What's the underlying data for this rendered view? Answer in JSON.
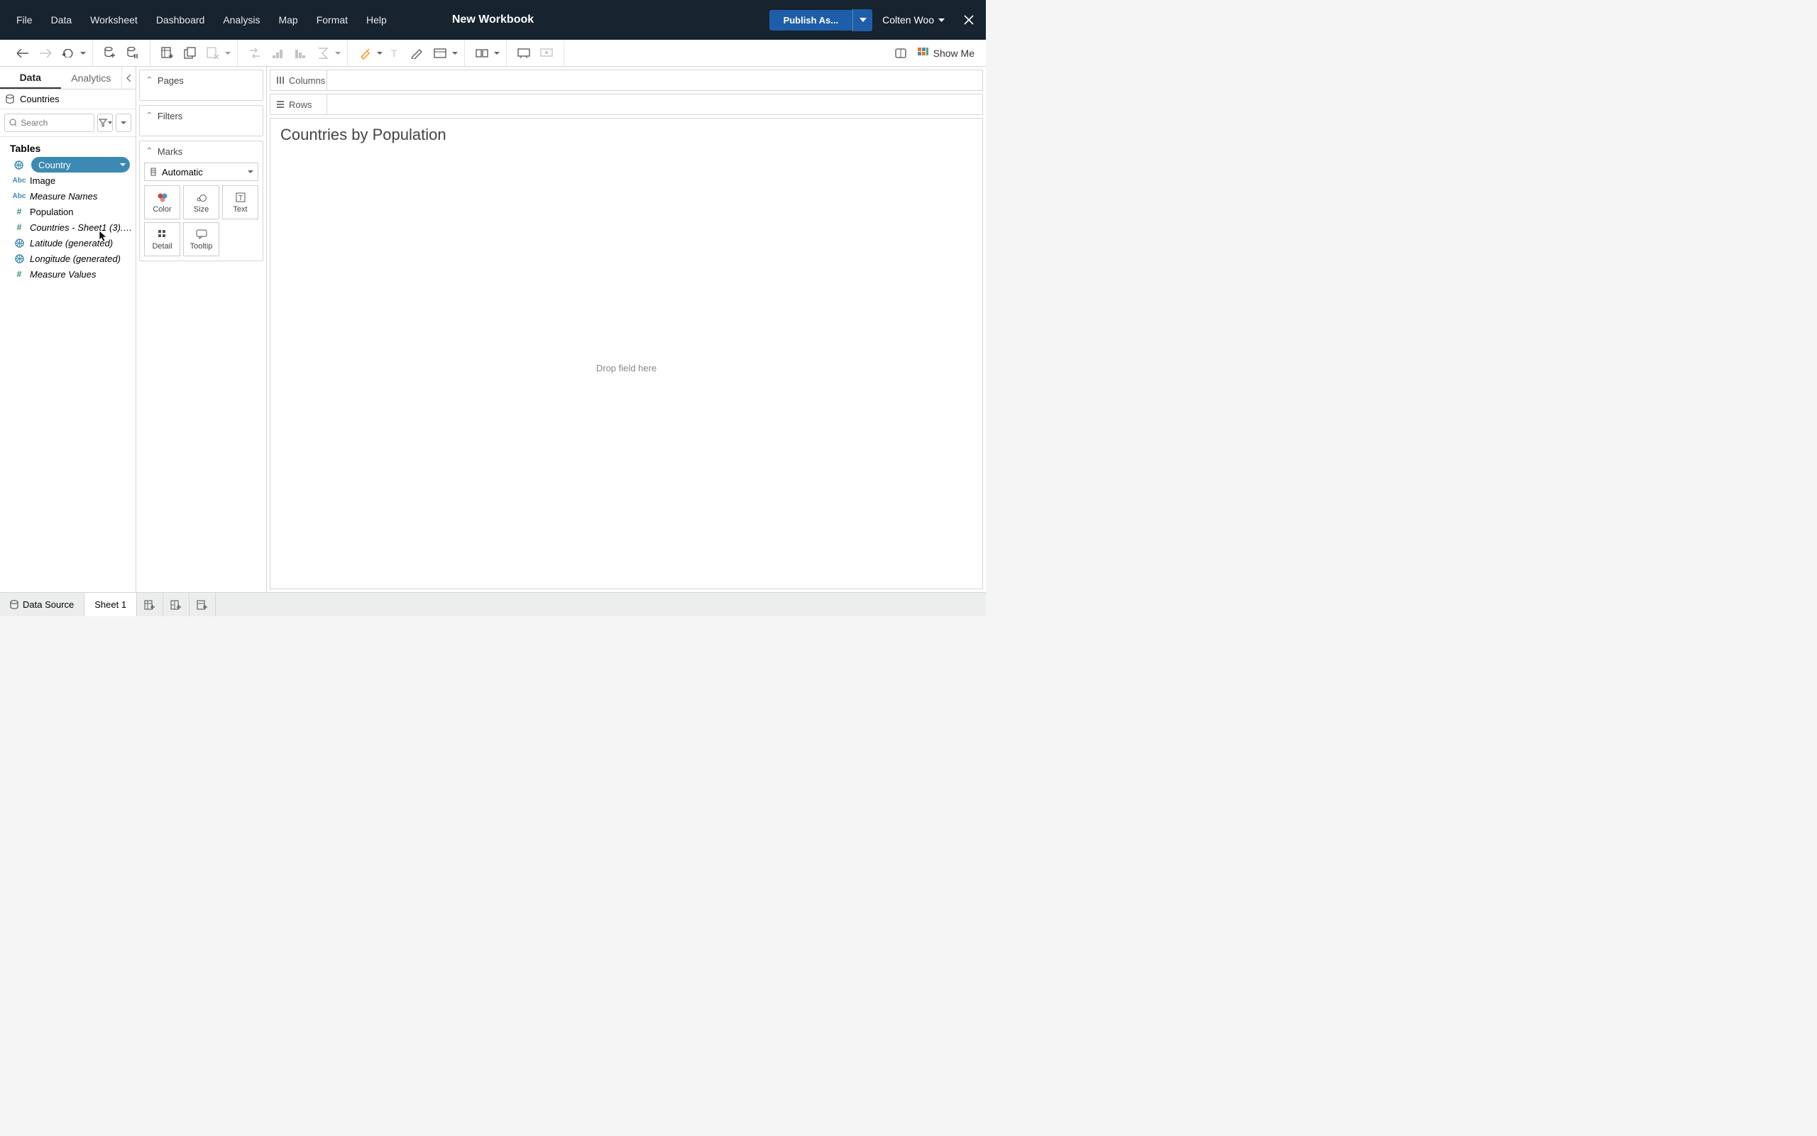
{
  "title": "New Workbook",
  "menus": [
    "File",
    "Data",
    "Worksheet",
    "Dashboard",
    "Analysis",
    "Map",
    "Format",
    "Help"
  ],
  "publish_label": "Publish As...",
  "user_name": "Colten Woo",
  "showme_label": "Show Me",
  "sidebar": {
    "tabs": {
      "data": "Data",
      "analytics": "Analytics"
    },
    "datasource": "Countries",
    "search_placeholder": "Search",
    "tables_label": "Tables",
    "fields": [
      {
        "name": "Country",
        "type": "geo",
        "role": "dimension",
        "selected": true
      },
      {
        "name": "Image",
        "type": "abc",
        "role": "dimension"
      },
      {
        "name": "Measure Names",
        "type": "abc",
        "role": "dimension",
        "italic": true
      },
      {
        "name": "Population",
        "type": "num",
        "role": "measure"
      },
      {
        "name": "Countries - Sheet1 (3).c...",
        "type": "num",
        "role": "measure",
        "italic": true
      },
      {
        "name": "Latitude (generated)",
        "type": "geo",
        "role": "measure",
        "italic": true
      },
      {
        "name": "Longitude (generated)",
        "type": "geo",
        "role": "measure",
        "italic": true
      },
      {
        "name": "Measure Values",
        "type": "num",
        "role": "measure",
        "italic": true
      }
    ]
  },
  "cards": {
    "pages": "Pages",
    "filters": "Filters",
    "marks": "Marks",
    "automatic": "Automatic",
    "cells": {
      "color": "Color",
      "size": "Size",
      "text": "Text",
      "detail": "Detail",
      "tooltip": "Tooltip"
    }
  },
  "shelves": {
    "columns": "Columns",
    "rows": "Rows"
  },
  "view": {
    "title": "Countries by Population",
    "drop_hint": "Drop field here"
  },
  "bottom": {
    "datasource": "Data Source",
    "sheet": "Sheet 1"
  }
}
